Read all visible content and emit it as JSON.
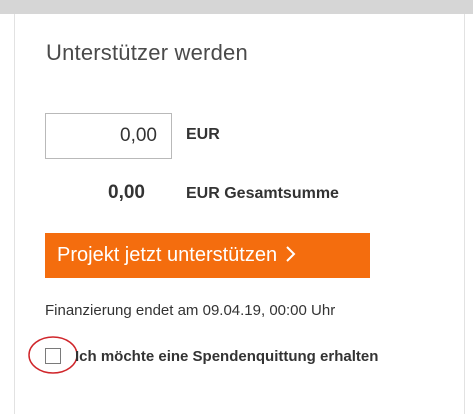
{
  "card": {
    "title": "Unterstützer werden"
  },
  "amount": {
    "value": "0,00",
    "currency": "EUR"
  },
  "total": {
    "value": "0,00",
    "label": "EUR Gesamtsumme"
  },
  "cta": {
    "label": "Projekt jetzt unterstützen",
    "icon": "chevron-right-icon",
    "color": "#f46d0e"
  },
  "funding": {
    "text": "Finanzierung endet am 09.04.19, 00:00 Uhr"
  },
  "receipt": {
    "label": "Ich möchte eine Spendenquittung erhalten",
    "checked": false,
    "highlight_color": "#d0262b"
  }
}
